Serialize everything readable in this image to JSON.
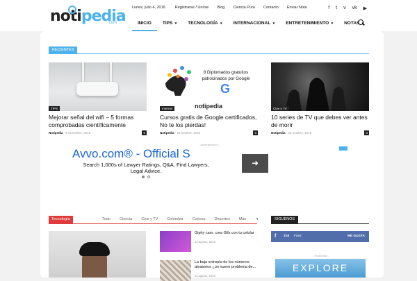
{
  "header": {
    "logo_main": "noti",
    "logo_accent": "pedia",
    "logo_sub": ".com",
    "date": "Lunes, julio 4, 2016",
    "top_links": [
      "Registrarse / Unirse",
      "Blog",
      "Ciencia Pura",
      "Contacto",
      "Enviar Nota"
    ],
    "social_icons": [
      "facebook-icon",
      "twitter-icon",
      "vimeo-icon",
      "vk-icon",
      "youtube-icon"
    ],
    "social_glyphs": [
      "f",
      "t",
      "v",
      "vk",
      "▶"
    ],
    "nav": [
      {
        "label": "INICIO",
        "active": true,
        "dropdown": false
      },
      {
        "label": "TIPS",
        "active": false,
        "dropdown": true
      },
      {
        "label": "TECNOLOGÍA",
        "active": false,
        "dropdown": true
      },
      {
        "label": "INTERNACIONAL",
        "active": false,
        "dropdown": true
      },
      {
        "label": "ENTRETENIMIENTO",
        "active": false,
        "dropdown": true
      },
      {
        "label": "NOTAS",
        "active": false,
        "dropdown": true
      }
    ]
  },
  "recent_block": {
    "label": "RECIENTES",
    "cards": [
      {
        "category": "TIPS",
        "title": "Mejorar señal del wifi – 5 formas comprobadas científicamente",
        "author": "Notipedia",
        "date": "5 diciembre, 2015",
        "comments": "0"
      },
      {
        "category": "Internet",
        "title": "Cursos gratis de Google certificados, No te los pierdas!",
        "author": "Notipedia",
        "date": "23 octubre, 2015",
        "comments": "0",
        "image_text": "8 Diplomados gratuitos patrocinados por Google",
        "image_logo": "notipedia"
      },
      {
        "category": "Cine y TV",
        "title": "10 series de TV que debes ver antes de morir",
        "author": "Notipedia",
        "date": "22 octubre, 2015",
        "comments": "0"
      }
    ]
  },
  "ad": {
    "label": "- Advertisement -",
    "title": "Avvo.com® - Official S",
    "text": "Search 1,000s of Lawyer Ratings, Q&A, Find Lawyers, Legal Advice.",
    "button_glyph": "➜"
  },
  "tech_block": {
    "label": "Tecnología",
    "subcategories": [
      "Todo",
      "Ciencia",
      "Cine y TV",
      "Colombia",
      "Curioso",
      "Deportes",
      "Más"
    ],
    "posts": [
      {
        "title": "Giphy cam, crea Gifs con tu celular",
        "date": "20 agosto, 2015"
      },
      {
        "title": "La baja entropía de los números aleatorios ¿un nuevo problema de...",
        "date": "11 agosto, 2015"
      }
    ]
  },
  "sidebar": {
    "label": "SIGUENOS",
    "fb_icon": "f",
    "fb_count": "216",
    "fb_fans": "Fans",
    "fb_like": "ME GUSTA",
    "ad_label": "- Publicidad -",
    "ad_text": "EXPLORE"
  }
}
